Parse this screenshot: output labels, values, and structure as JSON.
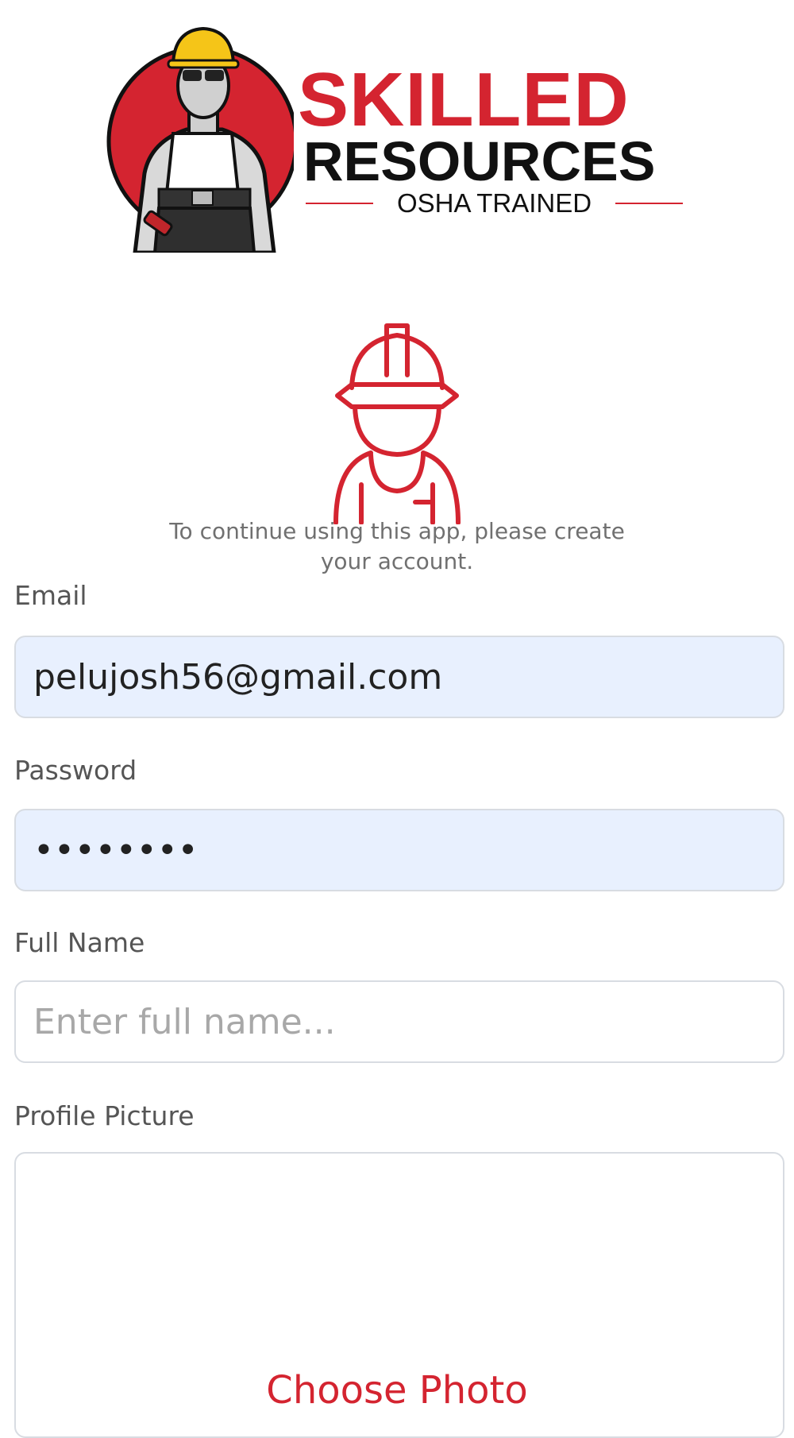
{
  "logo": {
    "line1": "SKILLED",
    "line2": "RESOURCES",
    "line3": "OSHA TRAINED"
  },
  "intro": {
    "text": "To continue using this app, please create your account."
  },
  "form": {
    "email": {
      "label": "Email",
      "value": "pelujosh56@gmail.com"
    },
    "password": {
      "label": "Password",
      "value": "••••••••"
    },
    "full_name": {
      "label": "Full Name",
      "placeholder": "Enter full name..."
    },
    "profile_picture": {
      "label": "Profile Picture",
      "button_label": "Choose Photo"
    }
  },
  "icons": {
    "logo": "construction-worker-mascot-icon",
    "avatar": "hard-hat-worker-icon"
  },
  "colors": {
    "brand_red": "#d42430",
    "autofill_bg": "#e8f0fe",
    "border": "#d8dce2"
  }
}
